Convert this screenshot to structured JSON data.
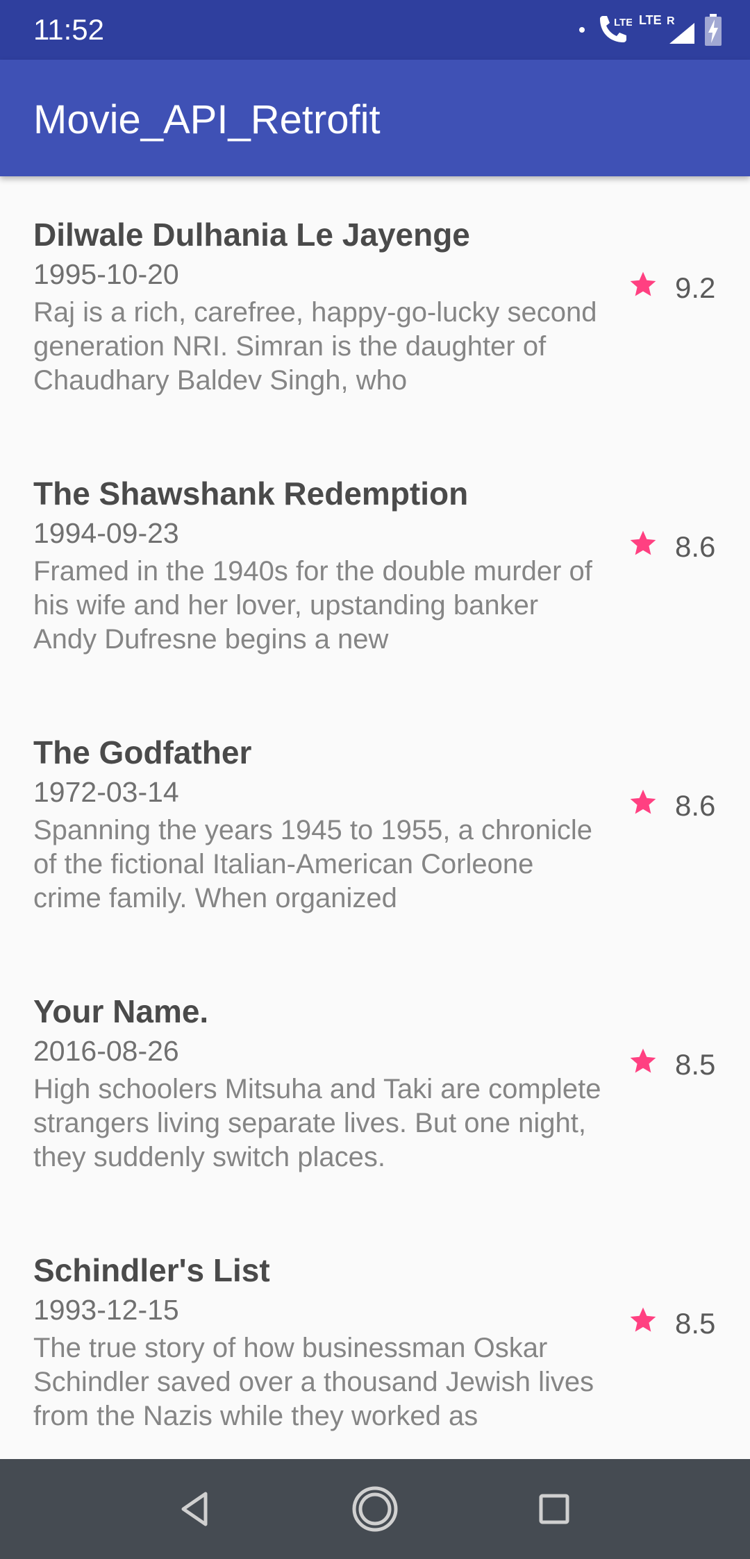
{
  "status_bar": {
    "time": "11:52",
    "network_label_1": "LTE",
    "network_label_2": "LTE",
    "network_label_3": "R",
    "icons": [
      "dot-icon",
      "wifi-call-icon",
      "signal-icon",
      "battery-icon"
    ]
  },
  "app_bar": {
    "title": "Movie_API_Retrofit",
    "color": "#3f51b5"
  },
  "movies": [
    {
      "title": "Dilwale Dulhania Le Jayenge",
      "date": "1995-10-20",
      "overview": "Raj is a rich, carefree, happy-go-lucky second generation NRI. Simran is the daughter of Chaudhary Baldev Singh, who",
      "rating": "9.2"
    },
    {
      "title": "The Shawshank Redemption",
      "date": "1994-09-23",
      "overview": "Framed in the 1940s for the double murder of his wife and her lover, upstanding banker Andy Dufresne begins a new",
      "rating": "8.6"
    },
    {
      "title": "The Godfather",
      "date": "1972-03-14",
      "overview": "Spanning the years 1945 to 1955, a chronicle of the fictional Italian-American Corleone crime family. When organized",
      "rating": "8.6"
    },
    {
      "title": "Your Name.",
      "date": "2016-08-26",
      "overview": "High schoolers Mitsuha and Taki are complete strangers living separate lives. But one night, they suddenly switch places.",
      "rating": "8.5"
    },
    {
      "title": "Schindler's List",
      "date": "1993-12-15",
      "overview": "The true story of how businessman Oskar Schindler saved over a thousand Jewish lives from the Nazis while they worked as",
      "rating": "8.5"
    }
  ],
  "colors": {
    "status_bar": "#2f3f9e",
    "accent_star": "#ff4081",
    "nav_bar": "#454b52"
  },
  "nav_bar": {
    "buttons": [
      "back-icon",
      "home-icon",
      "recents-icon"
    ]
  }
}
